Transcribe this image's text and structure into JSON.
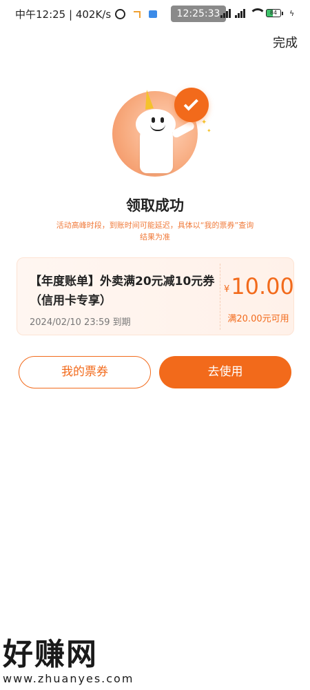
{
  "status_bar": {
    "left_text": "中午12:25 | 402K/s",
    "center_time": "12:25:33",
    "signal_label": "HD",
    "battery_level": "84"
  },
  "header": {
    "done_label": "完成"
  },
  "illustration": {
    "icon": "mascot-celebrating-icon"
  },
  "success": {
    "title": "领取成功",
    "note": "活动高峰时段，到账时间可能延迟，具体以“我的票券”查询结果为准"
  },
  "coupon": {
    "title": "【年度账单】外卖满20元减10元券（信用卡专享）",
    "expiry": "2024/02/10 23:59 到期",
    "currency": "¥",
    "amount": "10.00",
    "condition": "满20.00元可用"
  },
  "actions": {
    "my_coupons_label": "我的票券",
    "use_label": "去使用"
  },
  "watermark": {
    "logo": "好赚网",
    "url": "www.zhuanyes.com"
  },
  "colors": {
    "accent": "#f26a1b",
    "note": "#f07a3a"
  }
}
